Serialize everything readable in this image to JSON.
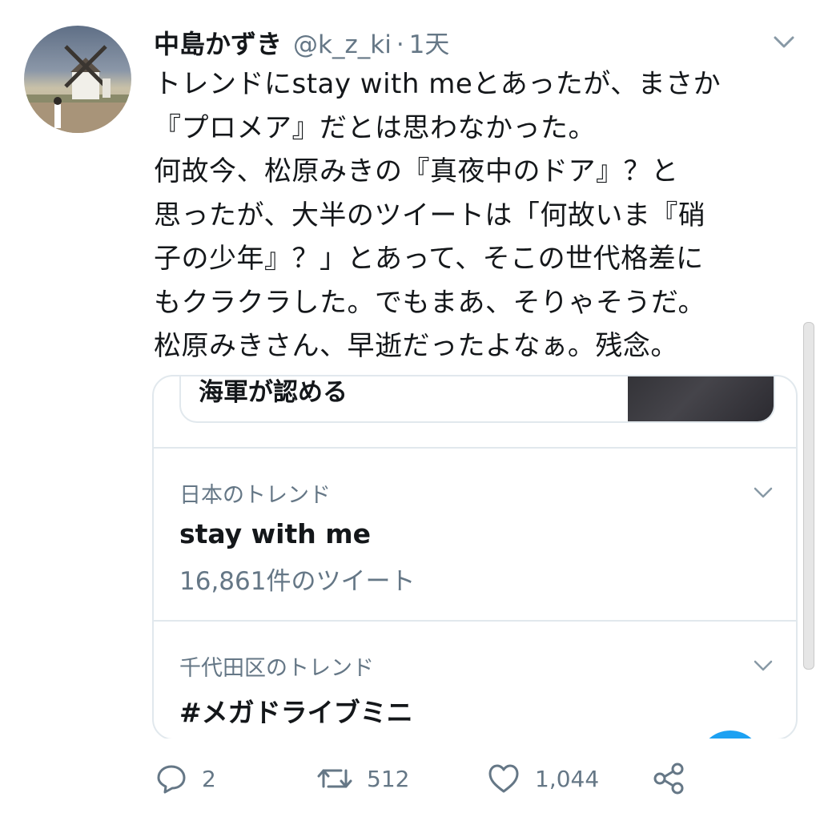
{
  "tweet": {
    "display_name": "中島かずき",
    "handle": "@k_z_ki",
    "separator": "·",
    "time": "1天",
    "avatar_icon": "windmill-avatar",
    "menu_icon": "chevron-down-icon",
    "text_lines": [
      "トレンドにstay with meとあったが、まさか",
      "『プロメア』だとは思わなかった。",
      "何故今、松原みきの『真夜中のドア』？と",
      "思ったが、大半のツイートは「何故いま『硝",
      "子の少年』？」とあって、そこの世代格差に",
      "もクラクラした。でもまあ、そりゃそうだ。",
      "松原みきさん、早逝だったよなぁ。残念。"
    ]
  },
  "embedded_card": {
    "partial_text": "海軍が認める",
    "trends": [
      {
        "location": "日本のトレンド",
        "name": "stay with me",
        "count": "16,861件のツイート"
      },
      {
        "location": "千代田区のトレンド",
        "name": "#メガドライブミニ",
        "count": ""
      }
    ]
  },
  "actions": {
    "reply": {
      "icon": "reply-icon",
      "count": "2"
    },
    "retweet": {
      "icon": "retweet-icon",
      "count": "512"
    },
    "like": {
      "icon": "heart-icon",
      "count": "1,044"
    },
    "share": {
      "icon": "share-icon"
    }
  },
  "colors": {
    "accent": "#1da1f2",
    "secondary_text": "#657786",
    "border": "#e1e8ed",
    "primary_text": "#14171a"
  }
}
